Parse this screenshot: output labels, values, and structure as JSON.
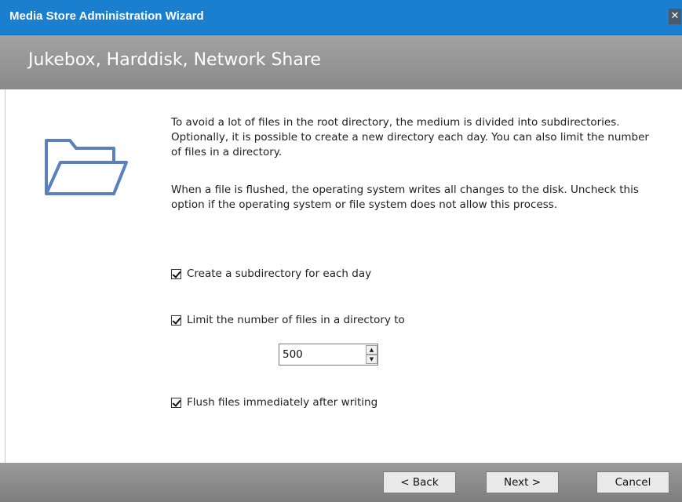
{
  "window": {
    "title": "Media Store Administration Wizard",
    "close_glyph": "✕"
  },
  "header": {
    "title": "Jukebox, Harddisk, Network Share"
  },
  "icon": {
    "name": "folder-icon",
    "color": "#5b7fbf"
  },
  "description": {
    "paragraph1": "To avoid a lot of files in the root directory, the medium is divided into subdirectories. Optionally, it is possible to create a new directory each day. You can also limit the number of files in a directory.",
    "paragraph2": "When a file is flushed, the operating system writes all changes to the disk. Uncheck this option if the operating system or file system does not allow this process."
  },
  "options": {
    "subdirectory_per_day": {
      "label": "Create a subdirectory for each day",
      "checked": true
    },
    "limit_files": {
      "label": "Limit the number of files in a directory to",
      "checked": true,
      "value": "500"
    },
    "flush_files": {
      "label": "Flush files immediately after writing",
      "checked": true
    }
  },
  "buttons": {
    "back": "< Back",
    "next": "Next >",
    "cancel": "Cancel"
  }
}
